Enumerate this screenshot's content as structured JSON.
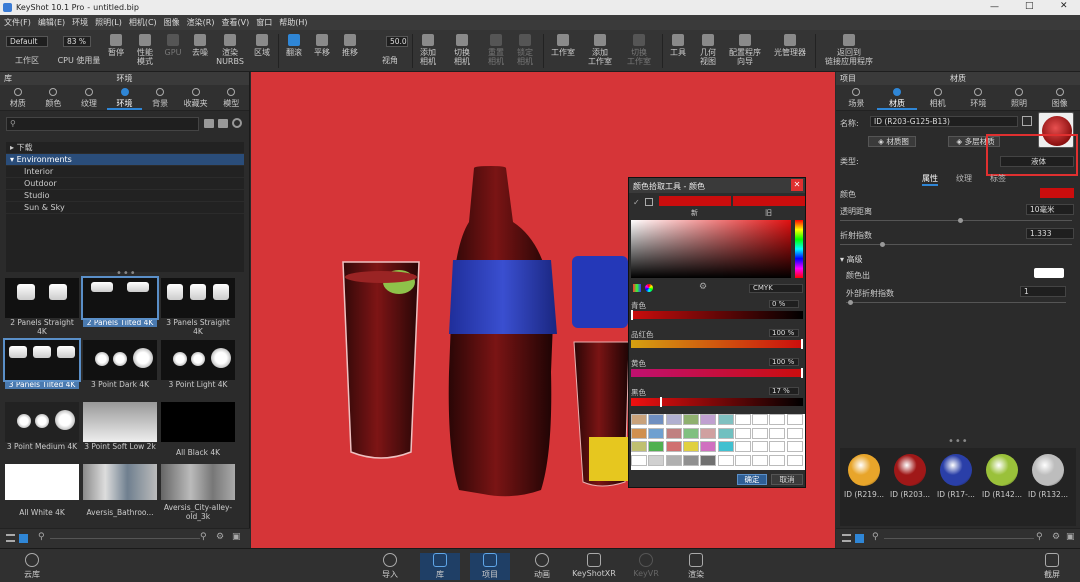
{
  "title": {
    "app": "KeyShot 10.1 Pro",
    "file": "untitled.bip"
  },
  "menu": [
    "文件(F)",
    "编辑(E)",
    "环境",
    "照明(L)",
    "相机(C)",
    "图像",
    "渲染(R)",
    "查看(V)",
    "窗口",
    "帮助(H)"
  ],
  "toolbar": {
    "workspace_value": "Default",
    "workspace_label": "工作区",
    "cpu_value": "83 %",
    "cpu_label": "CPU 使用量",
    "pause": "暂停",
    "perf_mode": "性能\n模式",
    "gpu": "GPU",
    "denoise": "去噪",
    "nurbs": "渲染\nNURBS",
    "region": "区域",
    "tumble": "翻滚",
    "pan": "平移",
    "dolly": "推移",
    "fov_value": "50.0",
    "fov_label": "视角",
    "add_camera": "添加\n相机",
    "switch_camera": "切换\n相机",
    "reset_camera": "重置\n相机",
    "lock_camera": "锁定\n相机",
    "studio": "工作室",
    "add_studio": "添加\n工作室",
    "switch_studio": "切换\n工作室",
    "tools": "工具",
    "geometry_view": "几何\n视图",
    "config_wizard": "配置程序\n向导",
    "light_manager": "光管理器",
    "back_to_linked": "返回到\n链接应用程序"
  },
  "left_panel": {
    "title_left": "库",
    "title": "环境",
    "tabs": [
      "材质",
      "颜色",
      "纹理",
      "环境",
      "背景",
      "收藏夹",
      "模型"
    ],
    "active_tab": "环境",
    "tree": [
      {
        "label": "下载",
        "level": 0
      },
      {
        "label": "Environments",
        "level": 0,
        "selected": true
      },
      {
        "label": "Interior",
        "level": 1
      },
      {
        "label": "Outdoor",
        "level": 1
      },
      {
        "label": "Studio",
        "level": 1
      },
      {
        "label": "Sun & Sky",
        "level": 1
      }
    ],
    "thumbnails": [
      "2 Panels Straight 4K",
      "2 Panels Tilted 4K",
      "3 Panels Straight 4K",
      "3 Panels Tilted 4K",
      "3 Point Dark 4K",
      "3 Point Light 4K",
      "3 Point Medium 4K",
      "3 Point Soft Low 2k",
      "All Black 4K",
      "All White 4K",
      "Aversis_Bathroo...",
      "Aversis_City-alley-old_3k"
    ]
  },
  "picker": {
    "title": "颜色拾取工具 - 颜色",
    "new_label": "新",
    "old_label": "旧",
    "mode": "CMYK",
    "channels": [
      {
        "label": "青色",
        "value": "0 %",
        "level": 0
      },
      {
        "label": "品红色",
        "value": "100 %",
        "level": 1
      },
      {
        "label": "黄色",
        "value": "100 %",
        "level": 1
      },
      {
        "label": "黑色",
        "value": "17 %",
        "level": 0.17
      }
    ],
    "ok": "确定",
    "cancel": "取消"
  },
  "right_panel": {
    "title_left": "项目",
    "title": "材质",
    "tabs": [
      "场景",
      "材质",
      "相机",
      "环境",
      "照明",
      "图像"
    ],
    "active_tab": "材质",
    "name_label": "名称:",
    "name_value": "ID (R203-G125-B13)",
    "material_graph": "材质图",
    "multi_layer": "多层材质",
    "type_label": "类型:",
    "type_value": "液体",
    "sub_tabs": [
      "属性",
      "纹理",
      "标签"
    ],
    "active_sub_tab": "属性",
    "color_label": "颜色",
    "transmission_label": "透明距离",
    "transmission_value": "10毫米",
    "ior_label": "折射指数",
    "ior_value": "1.333",
    "advanced_label": "高级",
    "color_out_label": "颜色出",
    "external_ior_label": "外部折射指数",
    "external_ior_value": "1",
    "materials": [
      {
        "label": "ID (R219...",
        "color": "#e8a52a"
      },
      {
        "label": "ID (R203...",
        "color": "#a01818"
      },
      {
        "label": "ID (R17-...",
        "color": "#2a3fa8"
      },
      {
        "label": "ID (R142...",
        "color": "#9ac13a"
      },
      {
        "label": "ID (R132...",
        "color": "#bdbdbd"
      }
    ]
  },
  "bottom_bar": {
    "cloud": "云库",
    "import": "导入",
    "library": "库",
    "project": "项目",
    "animation": "动画",
    "keyshotxr": "KeyShotXR",
    "keyvr": "KeyVR",
    "render": "渲染",
    "screenshot": "截屏"
  },
  "colors": {
    "accent": "#2f86d6",
    "viewport_bg": "#d63538",
    "material_red": "#cb0d0d",
    "highlight_box": "#e03030"
  }
}
